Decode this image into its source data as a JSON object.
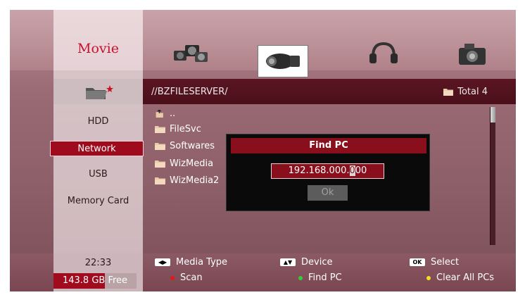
{
  "header": {
    "mode_title": "Movie"
  },
  "media_icons": [
    "photo-icon",
    "video-camera-icon",
    "headphones-icon",
    "camera-icon"
  ],
  "path_bar": {
    "path": "//BZFILESERVER/",
    "total_label": "Total 4"
  },
  "sources": [
    "HDD",
    "Network",
    "USB",
    "Memory Card"
  ],
  "selected_source": "Network",
  "files": [
    {
      "name": "..",
      "icon": "parent-folder-icon"
    },
    {
      "name": "FileSvc",
      "icon": "folder-icon"
    },
    {
      "name": "Softwares",
      "icon": "folder-icon"
    },
    {
      "name": "WizMedia",
      "icon": "folder-icon"
    },
    {
      "name": "WizMedia2",
      "icon": "folder-icon"
    }
  ],
  "dialog": {
    "title": "Find PC",
    "ip_before_cursor": "192.168.000.",
    "ip_cursor_char": "0",
    "ip_after_cursor": "00",
    "ok_label": "Ok"
  },
  "status": {
    "time": "22:33",
    "free_space": "143.8 GB Free"
  },
  "hints": {
    "media_type": "Media Type",
    "device": "Device",
    "select": "Select",
    "scan": "Scan",
    "find_pc": "Find PC",
    "clear_all": "Clear All PCs",
    "ok_key": "OK"
  },
  "colors": {
    "accent_red": "#9e0b1d",
    "scan_dot": "#e01a1a",
    "find_dot": "#3cc83c",
    "clear_dot": "#f0e020"
  }
}
